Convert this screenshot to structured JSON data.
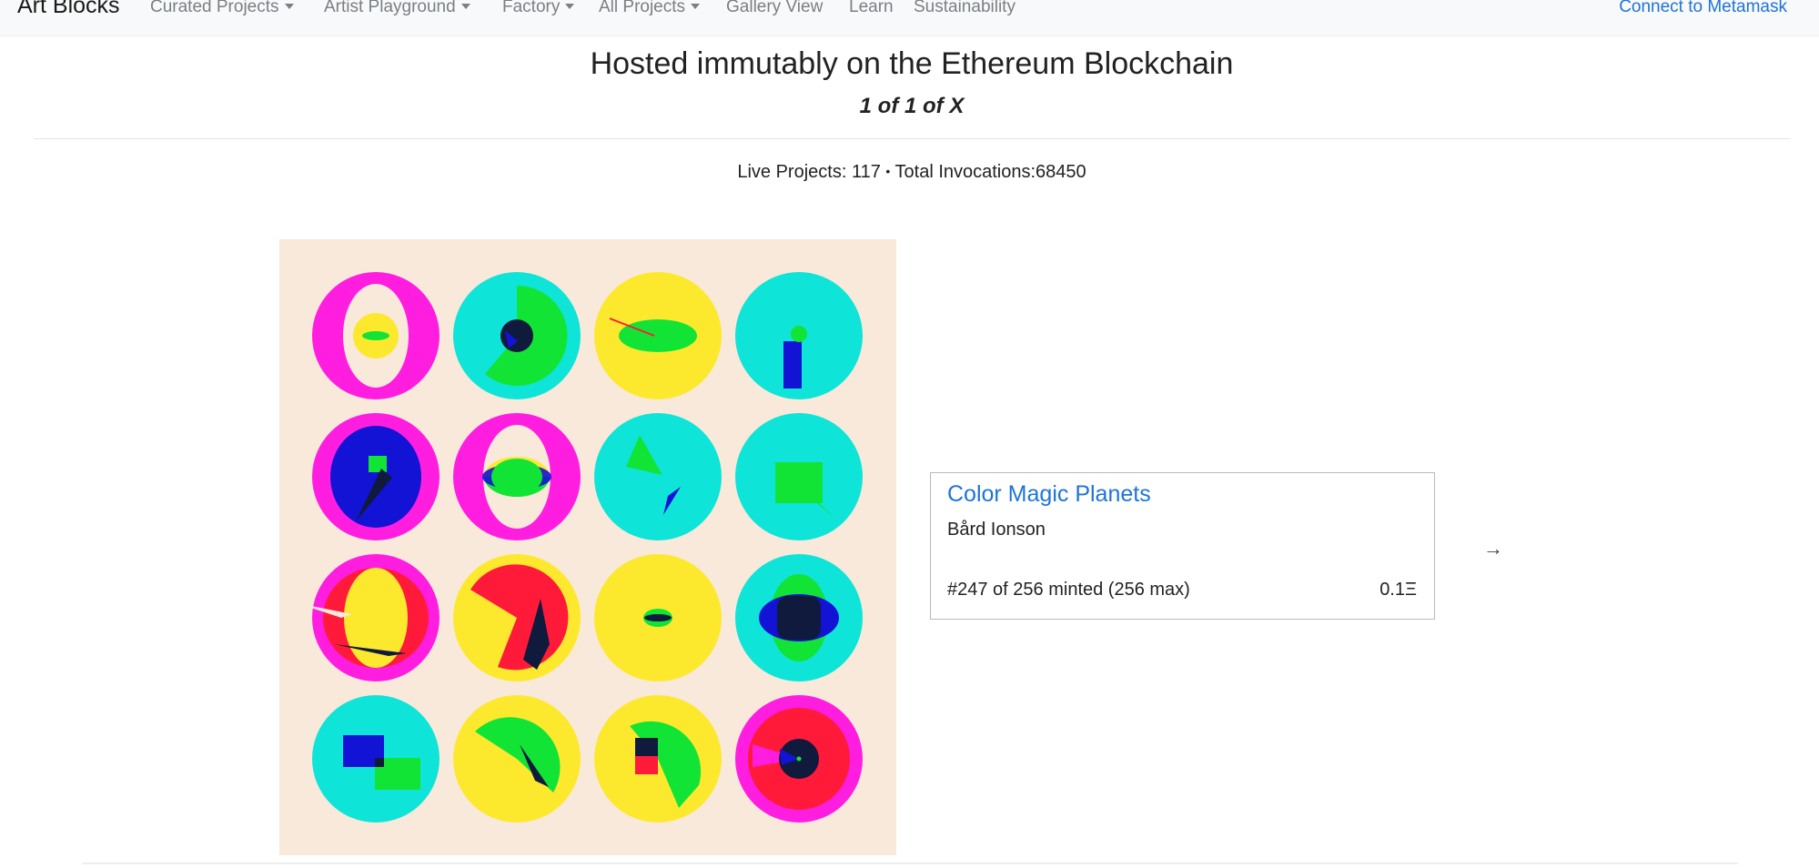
{
  "navbar": {
    "brand": "Art Blocks",
    "items": [
      {
        "label": "Curated Projects",
        "dropdown": true
      },
      {
        "label": "Artist Playground",
        "dropdown": true
      },
      {
        "label": "Factory",
        "dropdown": true
      },
      {
        "label": "All Projects",
        "dropdown": true
      },
      {
        "label": "Gallery View",
        "dropdown": false
      },
      {
        "label": "Learn",
        "dropdown": false
      },
      {
        "label": "Sustainability",
        "dropdown": false
      }
    ],
    "connect_label": "Connect to Metamask"
  },
  "hero": {
    "headline": "Hosted immutably on the Ethereum Blockchain",
    "subhead": "1 of 1 of X"
  },
  "stats": {
    "live_label": "Live Projects:",
    "live_count": "117",
    "separator": "•",
    "invocations_label": "Total Invocations:",
    "invocations_count": "68450"
  },
  "project": {
    "title": "Color Magic Planets",
    "artist": "Bård Ionson",
    "minted_text": "#247 of 256 minted (256 max)",
    "price": "0.1Ξ",
    "next_icon": "→"
  },
  "colors": {
    "accent": "#1d74d8",
    "artwork_background": "#f8e9da",
    "magenta": "#ff1ee0",
    "cyan": "#0fe4d8",
    "yellow": "#fce92e",
    "green": "#12e435",
    "blue": "#1313d6",
    "red": "#ff1a3a",
    "navy": "#0f1a3c"
  }
}
